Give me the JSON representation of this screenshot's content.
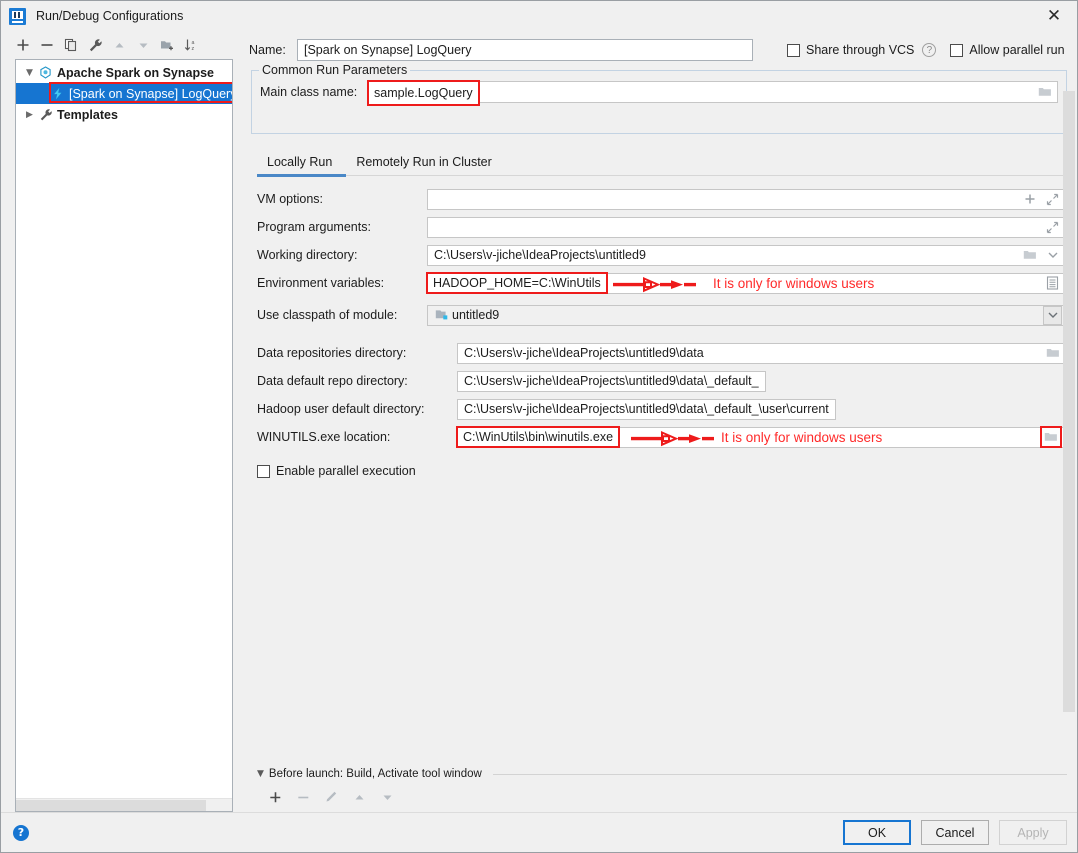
{
  "window": {
    "title": "Run/Debug Configurations",
    "app_icon": "intellij-idea-logo",
    "close_label": "✕"
  },
  "left_panel": {
    "toolbar": [
      {
        "name": "add-configuration-button",
        "icon": "plus-icon",
        "label": "+"
      },
      {
        "name": "remove-configuration-button",
        "icon": "minus-icon",
        "label": "−"
      },
      {
        "name": "copy-configuration-button",
        "icon": "copy-icon",
        "label": ""
      },
      {
        "name": "edit-templates-button",
        "icon": "wrench-icon",
        "label": ""
      },
      {
        "name": "move-up-button",
        "icon": "arrow-up-icon",
        "label": ""
      },
      {
        "name": "move-down-button",
        "icon": "arrow-down-icon",
        "label": ""
      },
      {
        "name": "create-folder-button",
        "icon": "folder-add-icon",
        "label": ""
      },
      {
        "name": "sort-configurations-button",
        "icon": "sort-alpha-icon",
        "label": ""
      }
    ],
    "tree": [
      {
        "label": "Apache Spark on Synapse",
        "icon": "spark-group-icon",
        "expanded": true,
        "selected": false,
        "level": 0
      },
      {
        "label": "[Spark on Synapse] LogQuery",
        "icon": "spark-run-config-icon",
        "expanded": false,
        "selected": true,
        "level": 1
      },
      {
        "label": "Templates",
        "icon": "wrench-icon",
        "expanded": false,
        "selected": false,
        "level": 0
      }
    ]
  },
  "header": {
    "name_label": "Name:",
    "name_value": "[Spark on Synapse] LogQuery",
    "share_vcs_label": "Share through VCS",
    "share_vcs_checked": false,
    "help_icon": "question-mark-icon",
    "allow_parallel_label": "Allow parallel run",
    "allow_parallel_checked": false
  },
  "common_run_parameters": {
    "group_title": "Common Run Parameters",
    "main_class_label": "Main class name:",
    "main_class_value": "sample.LogQuery",
    "browse_icon": "folder-icon"
  },
  "tabs": [
    {
      "label": "Locally Run",
      "active": true
    },
    {
      "label": "Remotely Run in Cluster",
      "active": false
    }
  ],
  "form": {
    "vm_options": {
      "label": "VM options:",
      "value": "",
      "icons": [
        "plus-icon",
        "expand-icon"
      ]
    },
    "program_arguments": {
      "label": "Program arguments:",
      "value": "",
      "icons": [
        "expand-icon"
      ]
    },
    "working_directory": {
      "label": "Working directory:",
      "value": "C:\\Users\\v-jiche\\IdeaProjects\\untitled9",
      "icons": [
        "folder-icon",
        "chevron-down-icon"
      ]
    },
    "environment_variables": {
      "label": "Environment variables:",
      "value": "HADOOP_HOME=C:\\WinUtils",
      "icons": [
        "list-edit-icon"
      ],
      "annotation": "It is only for windows users",
      "highlighted": true
    },
    "use_classpath_of_module": {
      "label": "Use classpath of module:",
      "value": "untitled9",
      "value_icon": "module-folder-icon",
      "icons": [
        "chevron-down-icon"
      ]
    },
    "data_repositories_directory": {
      "label": "Data repositories directory:",
      "value": "C:\\Users\\v-jiche\\IdeaProjects\\untitled9\\data",
      "icons": [
        "folder-icon"
      ]
    },
    "data_default_repo_directory": {
      "label": "Data default repo directory:",
      "value": "C:\\Users\\v-jiche\\IdeaProjects\\untitled9\\data\\_default_",
      "icons": []
    },
    "hadoop_user_default_directory": {
      "label": "Hadoop user default directory:",
      "value": "C:\\Users\\v-jiche\\IdeaProjects\\untitled9\\data\\_default_\\user\\current",
      "icons": []
    },
    "winutils_exe_location": {
      "label": "WINUTILS.exe location:",
      "value": "C:\\WinUtils\\bin\\winutils.exe",
      "icons": [
        "folder-icon"
      ],
      "annotation": "It is only for windows users",
      "highlighted": true,
      "browse_highlighted": true
    },
    "enable_parallel_execution": {
      "label": "Enable parallel execution",
      "checked": false
    }
  },
  "before_launch": {
    "collapse_icon": "triangle-down-icon",
    "title": "Before launch: Build, Activate tool window",
    "toolbar": [
      {
        "name": "add-before-launch-task-button",
        "icon": "plus-icon",
        "enabled": true
      },
      {
        "name": "remove-before-launch-task-button",
        "icon": "minus-icon",
        "enabled": false
      },
      {
        "name": "edit-before-launch-task-button",
        "icon": "pencil-icon",
        "enabled": false
      },
      {
        "name": "move-task-up-button",
        "icon": "arrow-up-icon",
        "enabled": false
      },
      {
        "name": "move-task-down-button",
        "icon": "arrow-down-icon",
        "enabled": false
      }
    ]
  },
  "footer": {
    "help_icon": "question-mark-icon",
    "ok_label": "OK",
    "cancel_label": "Cancel",
    "apply_label": "Apply",
    "apply_enabled": false
  },
  "colors": {
    "selection_blue": "#1675d1",
    "annotation_red": "#ff2a2a",
    "highlight_red": "#ee1b1b",
    "tab_underline": "#4a88c7",
    "dialog_bg": "#f0f0f0"
  }
}
